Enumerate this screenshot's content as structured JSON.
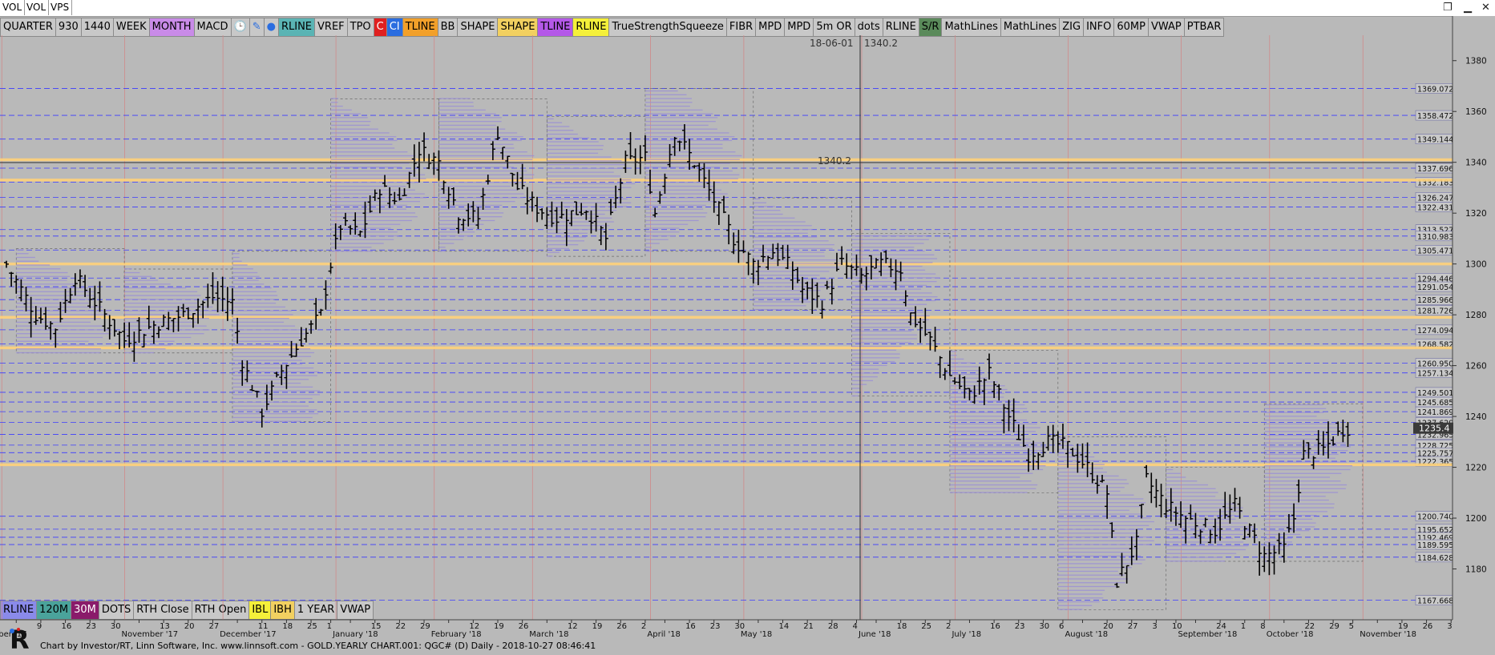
{
  "window": {
    "tabs": [
      "VOL",
      "VOL",
      "VPS"
    ]
  },
  "toolbar": [
    {
      "label": "QUARTER",
      "bg": "#c8c8c8"
    },
    {
      "label": "930",
      "bg": "#c8c8c8"
    },
    {
      "label": "1440",
      "bg": "#c8c8c8"
    },
    {
      "label": "WEEK",
      "bg": "#c8c8c8"
    },
    {
      "label": "MONTH",
      "bg": "#c98be8"
    },
    {
      "label": "MACD",
      "bg": "#c8c8c8"
    },
    {
      "label": "",
      "icon": "clock-icon",
      "bg": "#c8c8c8"
    },
    {
      "label": "",
      "icon": "pencil-icon",
      "bg": "#c8c8c8"
    },
    {
      "label": "",
      "icon": "bomb-icon",
      "bg": "#c8c8c8"
    },
    {
      "label": "RLINE",
      "bg": "#5ab4b4"
    },
    {
      "label": "VREF",
      "bg": "#c8c8c8"
    },
    {
      "label": "TPO",
      "bg": "#c8c8c8"
    },
    {
      "label": "C",
      "bg": "#e02020"
    },
    {
      "label": "CI",
      "bg": "#2a6de0"
    },
    {
      "label": "TLINE",
      "bg": "#f2a02a"
    },
    {
      "label": "BB",
      "bg": "#c8c8c8"
    },
    {
      "label": "SHAPE",
      "bg": "#c8c8c8"
    },
    {
      "label": "SHAPE",
      "bg": "#f2d060"
    },
    {
      "label": "TLINE",
      "bg": "#b458e8"
    },
    {
      "label": "RLINE",
      "bg": "#f5f03a"
    },
    {
      "label": "TrueStrengthSqueeze",
      "bg": "#c8c8c8"
    },
    {
      "label": "FIBR",
      "bg": "#c8c8c8"
    },
    {
      "label": "MPD",
      "bg": "#c8c8c8"
    },
    {
      "label": "MPD",
      "bg": "#c8c8c8"
    },
    {
      "label": "5m OR",
      "bg": "#c8c8c8"
    },
    {
      "label": "dots",
      "bg": "#c8c8c8"
    },
    {
      "label": "RLINE",
      "bg": "#c8c8c8"
    },
    {
      "label": "S/R",
      "bg": "#5a8a5a"
    },
    {
      "label": "MathLines",
      "bg": "#c8c8c8"
    },
    {
      "label": "MathLines",
      "bg": "#c8c8c8"
    },
    {
      "label": "ZIG",
      "bg": "#c8c8c8"
    },
    {
      "label": "INFO",
      "bg": "#c8c8c8"
    },
    {
      "label": "60MP",
      "bg": "#c8c8c8"
    },
    {
      "label": "VWAP",
      "bg": "#c8c8c8"
    },
    {
      "label": "PTBAR",
      "bg": "#c8c8c8"
    }
  ],
  "bottom_toolbar": [
    {
      "label": "RLINE",
      "bg": "#8a8aea"
    },
    {
      "label": "120M",
      "bg": "#4aa39b"
    },
    {
      "label": "30M",
      "bg": "#8a1a6a"
    },
    {
      "label": "DOTS",
      "bg": "#c8c8c8"
    },
    {
      "label": "RTH Close",
      "bg": "#c8c8c8"
    },
    {
      "label": "RTH Open",
      "bg": "#c8c8c8"
    },
    {
      "label": "IBL",
      "bg": "#f5f03a"
    },
    {
      "label": "IBH",
      "bg": "#f2d060"
    },
    {
      "label": "1 YEAR",
      "bg": "#c8c8c8"
    },
    {
      "label": "VWAP",
      "bg": "#c8c8c8"
    }
  ],
  "crosshair": {
    "date_label": "18-06-01",
    "price_label": "1340.2",
    "line_label": "1340.2"
  },
  "footer": "Chart by Investor/RT, Linn Software, Inc. www.linnsoft.com - GOLD.YEARLY CHART.001: QGC# (D) Daily - 2018-10-27 08:46:41",
  "colors": {
    "background": "#b9b9b9",
    "blue_lines": "#3a3aff",
    "orange_lines": "#ffd27a",
    "profile": "#9a8fd6",
    "bars": "#000000"
  },
  "chart_data": {
    "type": "ohlc",
    "ylim": [
      1160,
      1390
    ],
    "y_ticks": [
      1180,
      1200,
      1220,
      1240,
      1260,
      1280,
      1300,
      1320,
      1340,
      1360,
      1380
    ],
    "last_price": "1235.4",
    "level_labels": [
      "1369.0728",
      "1358.4725",
      "1349.1443",
      "1337.6960",
      "1332.1838",
      "1326.2477",
      "1322.4316",
      "1313.5275",
      "1310.9834",
      "1305.4712",
      "1294.4469",
      "1291.0549",
      "1285.9668",
      "1281.7267",
      "1274.0945",
      "1268.5823",
      "1260.9502",
      "1257.1340",
      "1249.5018",
      "1245.6858",
      "1241.8698",
      "1237.6296",
      "1232.9655",
      "1228.7253",
      "1225.7573",
      "1222.3652",
      "1200.7407",
      "1195.6526",
      "1192.4692",
      "1189.5954",
      "1184.6283",
      "1167.6680"
    ],
    "orange_levels": [
      1341,
      1333,
      1300,
      1279,
      1267,
      1221
    ],
    "x_labels": [
      {
        "t": "ber '17",
        "i": 2
      },
      {
        "t": "9",
        "i": 7
      },
      {
        "t": "16",
        "i": 12
      },
      {
        "t": "23",
        "i": 17
      },
      {
        "t": "30",
        "i": 22
      },
      {
        "t": "November '17",
        "i": 27
      },
      {
        "t": "13",
        "i": 32
      },
      {
        "t": "20",
        "i": 37
      },
      {
        "t": "27",
        "i": 42
      },
      {
        "t": "December '17",
        "i": 47
      },
      {
        "t": "11",
        "i": 52
      },
      {
        "t": "18",
        "i": 57
      },
      {
        "t": "25",
        "i": 62
      },
      {
        "t": "1",
        "i": 66
      },
      {
        "t": "January '18",
        "i": 70
      },
      {
        "t": "15",
        "i": 75
      },
      {
        "t": "22",
        "i": 80
      },
      {
        "t": "29",
        "i": 85
      },
      {
        "t": "February '18",
        "i": 90
      },
      {
        "t": "12",
        "i": 95
      },
      {
        "t": "19",
        "i": 100
      },
      {
        "t": "26",
        "i": 105
      },
      {
        "t": "March '18",
        "i": 110
      },
      {
        "t": "12",
        "i": 115
      },
      {
        "t": "19",
        "i": 120
      },
      {
        "t": "26",
        "i": 125
      },
      {
        "t": "2",
        "i": 130
      },
      {
        "t": "April '18",
        "i": 134
      },
      {
        "t": "16",
        "i": 139
      },
      {
        "t": "23",
        "i": 144
      },
      {
        "t": "30",
        "i": 149
      },
      {
        "t": "May '18",
        "i": 153
      },
      {
        "t": "14",
        "i": 158
      },
      {
        "t": "21",
        "i": 163
      },
      {
        "t": "28",
        "i": 168
      },
      {
        "t": "4",
        "i": 173
      },
      {
        "t": "June '18",
        "i": 177
      },
      {
        "t": "18",
        "i": 182
      },
      {
        "t": "25",
        "i": 187
      },
      {
        "t": "2",
        "i": 192
      },
      {
        "t": "July '18",
        "i": 196
      },
      {
        "t": "16",
        "i": 201
      },
      {
        "t": "23",
        "i": 206
      },
      {
        "t": "30",
        "i": 211
      },
      {
        "t": "6",
        "i": 215
      },
      {
        "t": "August '18",
        "i": 219
      },
      {
        "t": "20",
        "i": 224
      },
      {
        "t": "27",
        "i": 229
      },
      {
        "t": "3",
        "i": 234
      },
      {
        "t": "10",
        "i": 238
      },
      {
        "t": "September '18",
        "i": 242
      },
      {
        "t": "24",
        "i": 247
      },
      {
        "t": "1",
        "i": 252
      },
      {
        "t": "8",
        "i": 256
      },
      {
        "t": "October '18",
        "i": 260
      },
      {
        "t": "22",
        "i": 265
      },
      {
        "t": "29",
        "i": 270
      },
      {
        "t": "5",
        "i": 274
      },
      {
        "t": "November '18",
        "i": 279
      },
      {
        "t": "19",
        "i": 284
      },
      {
        "t": "26",
        "i": 289
      },
      {
        "t": "3",
        "i": 294
      }
    ],
    "n_slots": 300,
    "close_waypoints": [
      [
        0,
        1300
      ],
      [
        6,
        1280
      ],
      [
        10,
        1275
      ],
      [
        14,
        1295
      ],
      [
        18,
        1285
      ],
      [
        24,
        1270
      ],
      [
        30,
        1276
      ],
      [
        36,
        1280
      ],
      [
        42,
        1287
      ],
      [
        46,
        1285
      ],
      [
        48,
        1262
      ],
      [
        52,
        1242
      ],
      [
        56,
        1258
      ],
      [
        60,
        1270
      ],
      [
        64,
        1280
      ],
      [
        66,
        1300
      ],
      [
        68,
        1315
      ],
      [
        72,
        1312
      ],
      [
        76,
        1330
      ],
      [
        80,
        1325
      ],
      [
        84,
        1345
      ],
      [
        88,
        1340
      ],
      [
        92,
        1320
      ],
      [
        96,
        1318
      ],
      [
        100,
        1352
      ],
      [
        104,
        1330
      ],
      [
        108,
        1322
      ],
      [
        112,
        1318
      ],
      [
        118,
        1322
      ],
      [
        122,
        1310
      ],
      [
        126,
        1340
      ],
      [
        130,
        1342
      ],
      [
        132,
        1320
      ],
      [
        136,
        1352
      ],
      [
        140,
        1340
      ],
      [
        144,
        1325
      ],
      [
        148,
        1310
      ],
      [
        152,
        1300
      ],
      [
        156,
        1305
      ],
      [
        160,
        1298
      ],
      [
        162,
        1290
      ],
      [
        166,
        1285
      ],
      [
        170,
        1300
      ],
      [
        174,
        1295
      ],
      [
        178,
        1300
      ],
      [
        182,
        1298
      ],
      [
        184,
        1280
      ],
      [
        188,
        1270
      ],
      [
        192,
        1256
      ],
      [
        196,
        1248
      ],
      [
        200,
        1257
      ],
      [
        204,
        1240
      ],
      [
        208,
        1225
      ],
      [
        212,
        1230
      ],
      [
        216,
        1228
      ],
      [
        220,
        1220
      ],
      [
        224,
        1210
      ],
      [
        226,
        1175
      ],
      [
        230,
        1190
      ],
      [
        232,
        1215
      ],
      [
        236,
        1205
      ],
      [
        240,
        1200
      ],
      [
        246,
        1195
      ],
      [
        250,
        1205
      ],
      [
        256,
        1185
      ],
      [
        260,
        1188
      ],
      [
        262,
        1200
      ],
      [
        264,
        1225
      ],
      [
        268,
        1227
      ],
      [
        272,
        1235
      ],
      [
        274,
        1236
      ]
    ],
    "profiles": [
      {
        "i0": 2,
        "i1": 24,
        "top": 1306,
        "bot": 1265,
        "poc": 1276,
        "w": 14
      },
      {
        "i0": 24,
        "i1": 46,
        "top": 1298,
        "bot": 1265,
        "poc": 1280,
        "w": 14
      },
      {
        "i0": 46,
        "i1": 66,
        "top": 1305,
        "bot": 1238,
        "poc": 1250,
        "w": 14
      },
      {
        "i0": 66,
        "i1": 88,
        "top": 1365,
        "bot": 1305,
        "poc": 1330,
        "w": 14
      },
      {
        "i0": 88,
        "i1": 110,
        "top": 1365,
        "bot": 1305,
        "poc": 1338,
        "w": 14
      },
      {
        "i0": 110,
        "i1": 130,
        "top": 1358,
        "bot": 1303,
        "poc": 1330,
        "w": 14
      },
      {
        "i0": 130,
        "i1": 152,
        "top": 1369,
        "bot": 1305,
        "poc": 1340,
        "w": 14
      },
      {
        "i0": 152,
        "i1": 172,
        "top": 1326,
        "bot": 1282,
        "poc": 1300,
        "w": 14
      },
      {
        "i0": 172,
        "i1": 192,
        "top": 1312,
        "bot": 1248,
        "poc": 1294,
        "w": 14
      },
      {
        "i0": 192,
        "i1": 214,
        "top": 1266,
        "bot": 1210,
        "poc": 1225,
        "w": 14
      },
      {
        "i0": 214,
        "i1": 236,
        "top": 1232,
        "bot": 1164,
        "poc": 1195,
        "w": 14
      },
      {
        "i0": 236,
        "i1": 256,
        "top": 1220,
        "bot": 1183,
        "poc": 1195,
        "w": 14
      },
      {
        "i0": 256,
        "i1": 276,
        "top": 1245,
        "bot": 1183,
        "poc": 1222,
        "w": 14
      }
    ]
  }
}
